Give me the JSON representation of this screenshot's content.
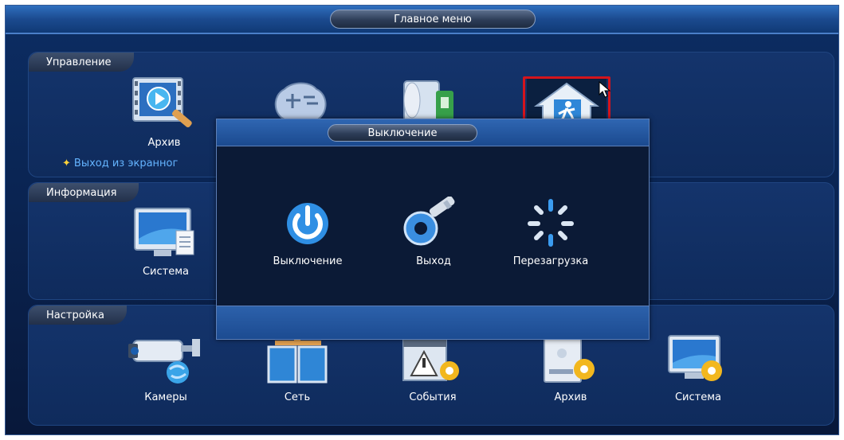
{
  "header": {
    "title": "Главное меню"
  },
  "sections": {
    "management": {
      "label": "Управление",
      "items": [
        {
          "label": "Архив",
          "icon": "playback-archive-icon"
        },
        {
          "label": "",
          "icon": "ai-brain-icon"
        },
        {
          "label": "",
          "icon": "backup-usb-icon"
        },
        {
          "label": "",
          "icon": "shutdown-exit-icon"
        }
      ],
      "hint": "Выход из экранног"
    },
    "info": {
      "label": "Информация",
      "items": [
        {
          "label": "Система",
          "icon": "system-info-monitor-icon"
        }
      ]
    },
    "settings": {
      "label": "Настройка",
      "items": [
        {
          "label": "Камеры",
          "icon": "camera-icon"
        },
        {
          "label": "Сеть",
          "icon": "network-icon"
        },
        {
          "label": "События",
          "icon": "events-settings-icon"
        },
        {
          "label": "Архив",
          "icon": "storage-settings-icon"
        },
        {
          "label": "Система",
          "icon": "system-settings-icon"
        }
      ]
    }
  },
  "dialog": {
    "title": "Выключение",
    "buttons": [
      {
        "label": "Выключение",
        "icon": "power-icon"
      },
      {
        "label": "Выход",
        "icon": "key-logout-icon"
      },
      {
        "label": "Перезагрузка",
        "icon": "reboot-spinner-icon"
      }
    ]
  },
  "colors": {
    "accent_blue": "#1b4a8f",
    "selection_red": "#d4141c",
    "hint_blue": "#64b4ff",
    "background_navy": "#0a2452"
  }
}
